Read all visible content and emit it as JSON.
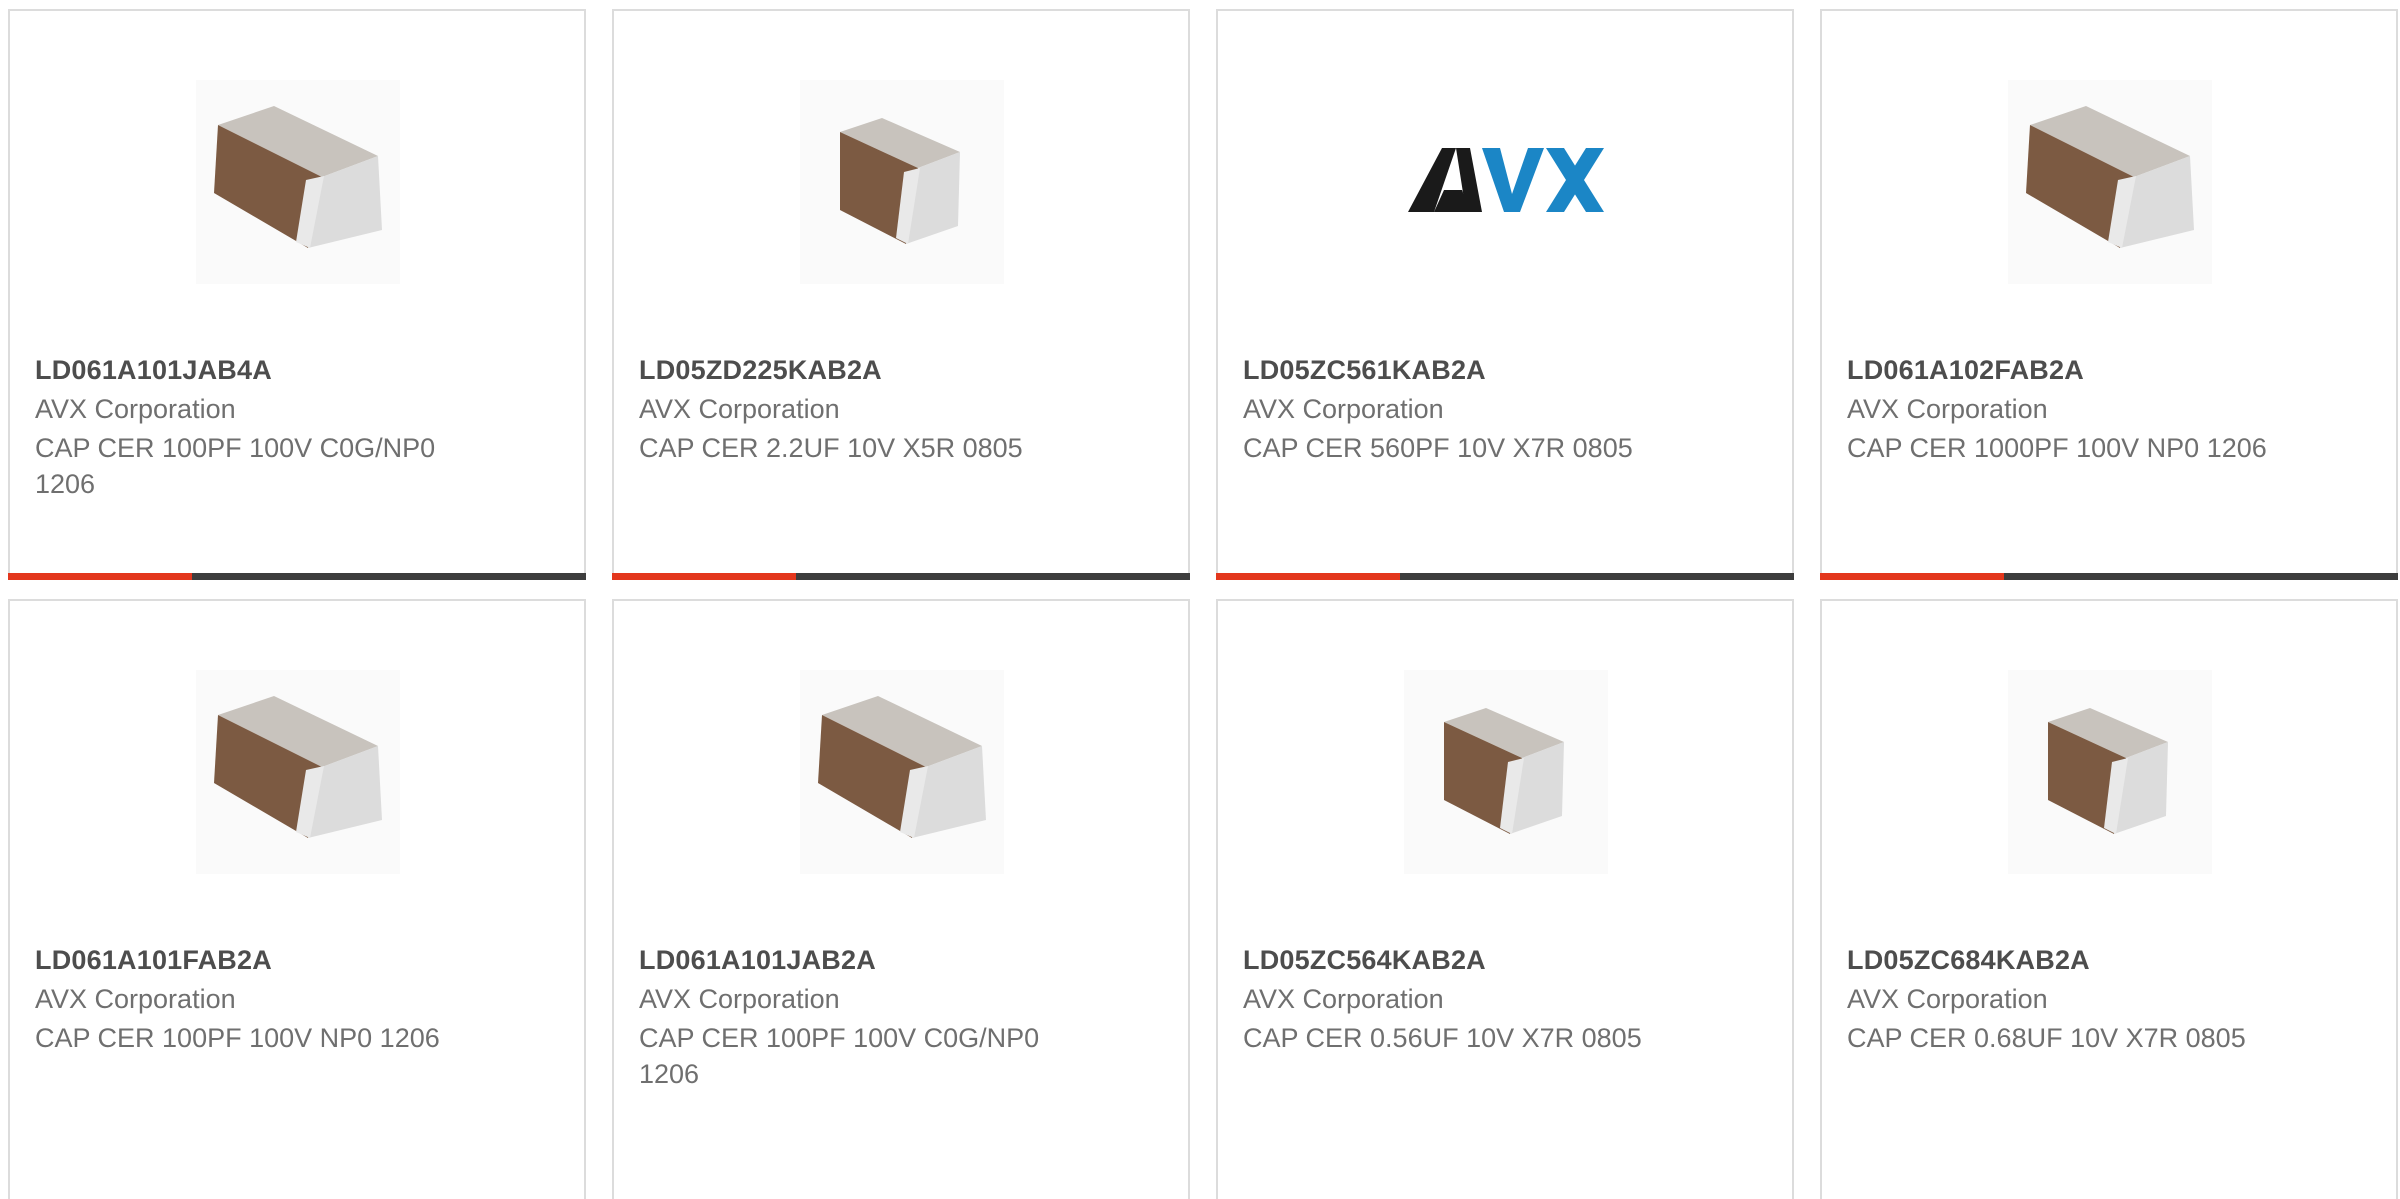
{
  "products": [
    {
      "part_number": "LD061A101JAB4A",
      "manufacturer": "AVX Corporation",
      "description": "CAP CER 100PF 100V C0G/NP0 1206",
      "image": "capacitor-1206-icon"
    },
    {
      "part_number": "LD05ZD225KAB2A",
      "manufacturer": "AVX Corporation",
      "description": "CAP CER 2.2UF 10V X5R 0805",
      "image": "capacitor-0805-icon"
    },
    {
      "part_number": "LD05ZC561KAB2A",
      "manufacturer": "AVX Corporation",
      "description": "CAP CER 560PF 10V X7R 0805",
      "image": "avx-logo",
      "logo_text": "AVX"
    },
    {
      "part_number": "LD061A102FAB2A",
      "manufacturer": "AVX Corporation",
      "description": "CAP CER 1000PF 100V NP0 1206",
      "image": "capacitor-1206-icon"
    },
    {
      "part_number": "LD061A101FAB2A",
      "manufacturer": "AVX Corporation",
      "description": "CAP CER 100PF 100V NP0 1206",
      "image": "capacitor-1206-icon"
    },
    {
      "part_number": "LD061A101JAB2A",
      "manufacturer": "AVX Corporation",
      "description": "CAP CER 100PF 100V C0G/NP0 1206",
      "image": "capacitor-1206-icon"
    },
    {
      "part_number": "LD05ZC564KAB2A",
      "manufacturer": "AVX Corporation",
      "description": "CAP CER 0.56UF 10V X7R 0805",
      "image": "capacitor-0805-icon"
    },
    {
      "part_number": "LD05ZC684KAB2A",
      "manufacturer": "AVX Corporation",
      "description": "CAP CER 0.68UF 10V X7R 0805",
      "image": "capacitor-0805-icon"
    }
  ],
  "colors": {
    "accent": "#e3371d",
    "bar": "#3d3d3d",
    "chip_body": "#7a5a42",
    "logo_black": "#1a1a1a",
    "logo_blue": "#1b86c6"
  }
}
